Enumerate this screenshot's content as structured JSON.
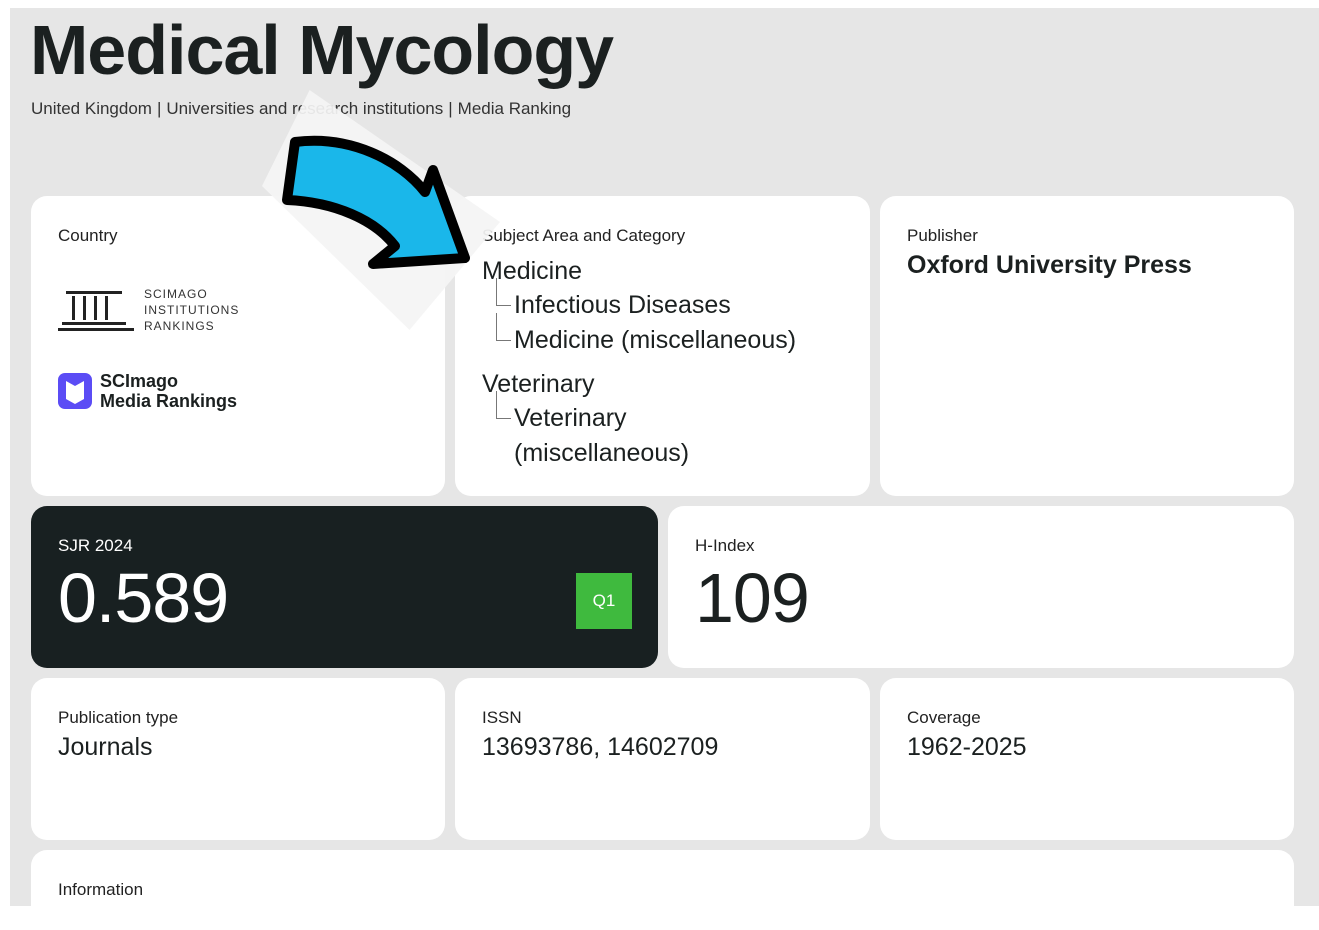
{
  "journal": {
    "title": "Medical Mycology",
    "subtitle": {
      "country": "United Kingdom",
      "owner_type": "Universities and research institutions",
      "ranking": "Media Ranking",
      "separator": "|"
    }
  },
  "country_card": {
    "label": "Country",
    "sir_logo_text": [
      "SCIMAGO",
      "INSTITUTIONS",
      "RANKINGS"
    ],
    "smr_logo_text": [
      "SCImago",
      "Media Rankings"
    ]
  },
  "subject_card": {
    "label": "Subject Area and Category",
    "areas": [
      {
        "name": "Medicine",
        "categories": [
          "Infectious Diseases",
          "Medicine (miscellaneous)"
        ]
      },
      {
        "name": "Veterinary",
        "categories": [
          "Veterinary (miscellaneous)"
        ]
      }
    ]
  },
  "publisher_card": {
    "label": "Publisher",
    "value": "Oxford University Press"
  },
  "sjr_card": {
    "label": "SJR 2024",
    "value": "0.589",
    "quartile": "Q1",
    "quartile_color": "#3fba3e"
  },
  "hindex_card": {
    "label": "H-Index",
    "value": "109"
  },
  "pubtype_card": {
    "label": "Publication type",
    "value": "Journals"
  },
  "issn_card": {
    "label": "ISSN",
    "value": "13693786, 14602709"
  },
  "coverage_card": {
    "label": "Coverage",
    "value": "1962-2025"
  },
  "info_card": {
    "label": "Information"
  },
  "overlay": {
    "arrow_color": "#1ab7ea",
    "icon": "arrow-icon"
  }
}
